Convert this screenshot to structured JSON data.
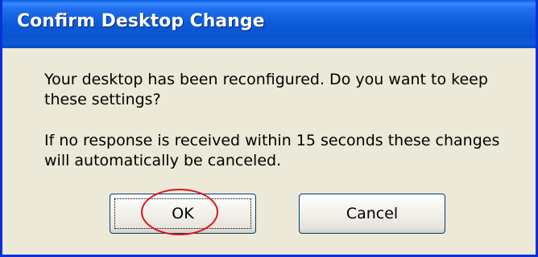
{
  "window": {
    "title": "Confirm Desktop Change"
  },
  "message": {
    "line_1": "Your desktop has been reconfigured.  Do you want to keep these settings?",
    "line_2": "If no response is received within 15 seconds these changes will automatically be canceled."
  },
  "buttons": {
    "ok_label": "OK",
    "cancel_label": "Cancel"
  },
  "colors": {
    "title_bar": "#0b5ad8",
    "dialog_background": "#ece9d8",
    "annotation": "#d8141a"
  }
}
